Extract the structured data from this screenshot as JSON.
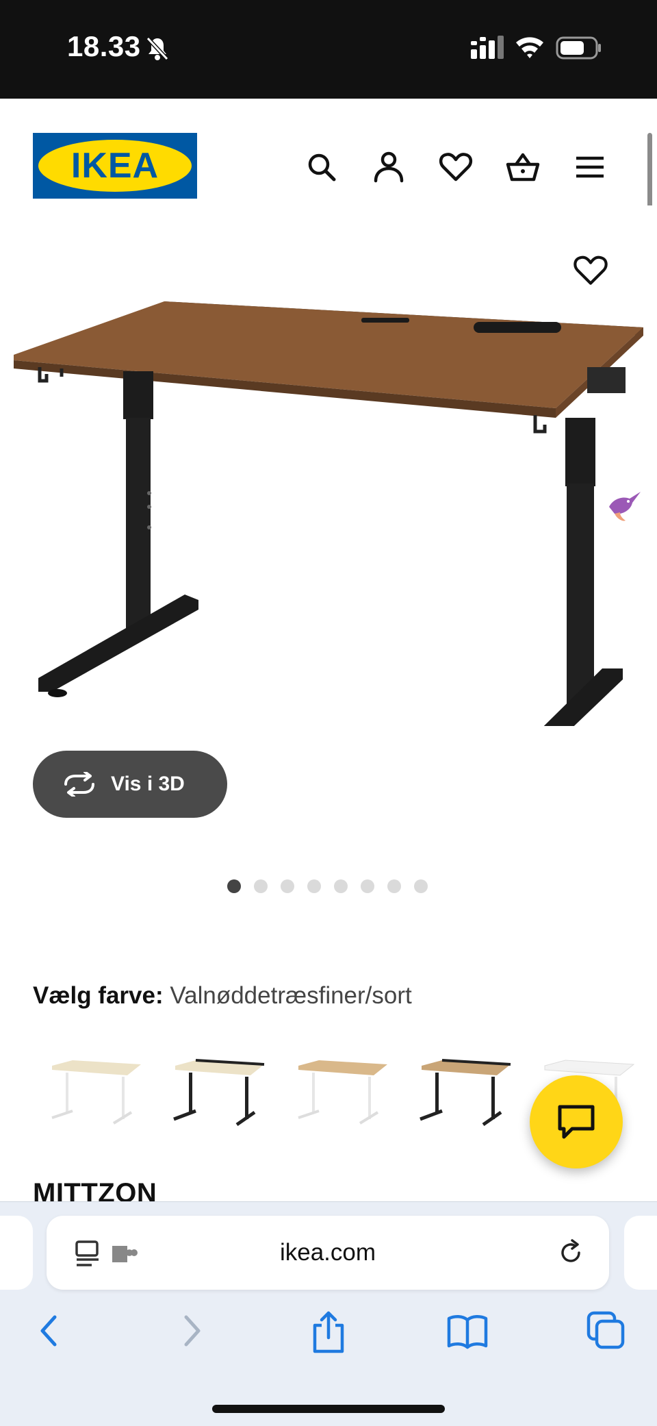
{
  "status": {
    "time": "18.33"
  },
  "header": {
    "logo_text": "IKEA",
    "brand_blue": "#0058a3",
    "brand_yellow": "#ffdb00",
    "icons": [
      "search-icon",
      "account-icon",
      "heart-icon",
      "basket-icon",
      "menu-icon"
    ]
  },
  "gallery": {
    "view_3d_label": "Vis i 3D",
    "image_count": 8,
    "active_index": 0
  },
  "product": {
    "color_label": "Vælg farve:",
    "color_value": "Valnøddetræsfiner/sort",
    "name": "MITTZON",
    "swatches": [
      {
        "top": "#ece2c7",
        "legs": "#f2f2f2"
      },
      {
        "top": "#ece2c7",
        "legs": "#222222"
      },
      {
        "top": "#d9b88a",
        "legs": "#f2f2f2"
      },
      {
        "top": "#c9a577",
        "legs": "#222222"
      },
      {
        "top": "#f3f3f3",
        "legs": "#f3f3f3"
      }
    ]
  },
  "browser": {
    "url": "ikea.com",
    "accent": "#1f7ae0"
  }
}
